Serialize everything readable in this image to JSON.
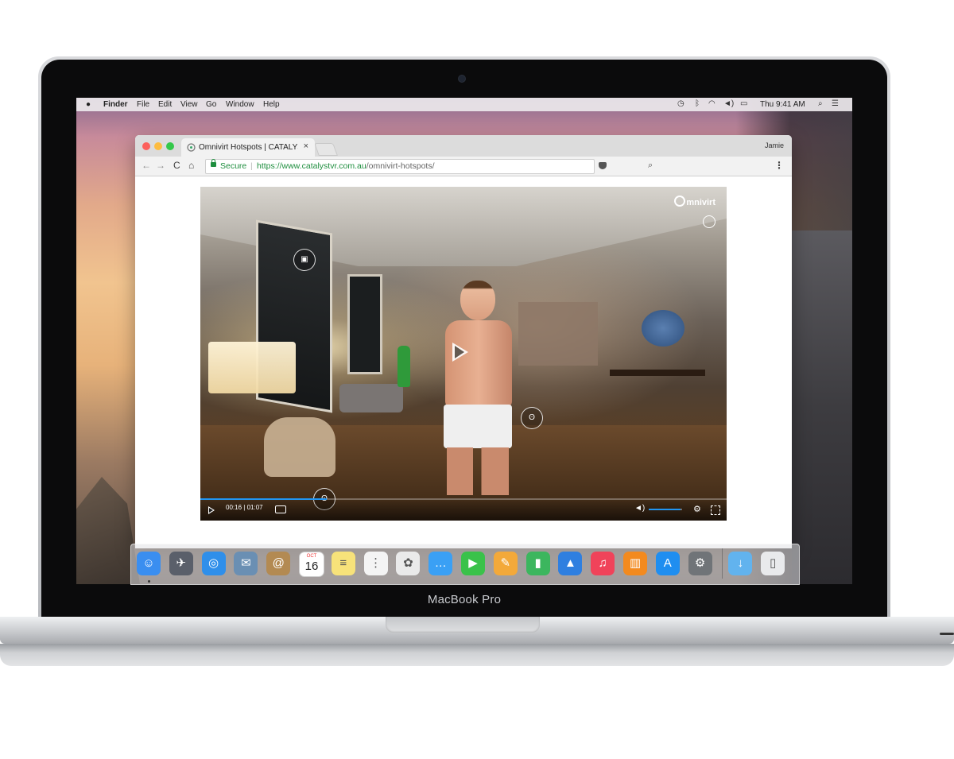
{
  "device": {
    "brand_label": "MacBook Pro"
  },
  "menubar": {
    "app_name": "Finder",
    "menus": [
      "File",
      "Edit",
      "View",
      "Go",
      "Window",
      "Help"
    ],
    "clock": "Thu 9:41 AM"
  },
  "browser": {
    "tab_title": "Omnivirt Hotspots | CATALYST",
    "tab_close": "×",
    "user_name": "Jamie",
    "security_label": "Secure",
    "url_base": "https://www.catalystvr.com.au",
    "url_path": "/omnivirt-hotspots/",
    "nav": {
      "back": "←",
      "forward": "→",
      "reload": "C",
      "home": "⌂"
    },
    "menu_glyph": "⋮"
  },
  "player": {
    "logo_text": "mnivirt",
    "time_current": "00:16",
    "time_separator": "|",
    "time_total": "01:07",
    "progress_fraction": 0.24,
    "volume_fraction": 0.95,
    "hotspots": [
      {
        "name": "hotspot-image",
        "glyph": "▣"
      },
      {
        "name": "hotspot-walk",
        "glyph": "ʘ"
      },
      {
        "name": "hotspot-bottom",
        "glyph": "ʘ"
      }
    ]
  },
  "dock": {
    "icons": [
      {
        "name": "finder-icon",
        "bg": "#3a8ef0",
        "glyph": "☺"
      },
      {
        "name": "launchpad-icon",
        "bg": "#5a5f6a",
        "glyph": "✈"
      },
      {
        "name": "safari-icon",
        "bg": "#2f8fea",
        "glyph": "◎"
      },
      {
        "name": "mail-stamp-icon",
        "bg": "#6a8fb3",
        "glyph": "✉"
      },
      {
        "name": "contacts-icon",
        "bg": "#b38a52",
        "glyph": "@"
      },
      {
        "name": "calendar-icon",
        "bg": "#ffffff",
        "glyph": ""
      },
      {
        "name": "notes-icon",
        "bg": "#f7e27a",
        "glyph": "≡"
      },
      {
        "name": "reminders-icon",
        "bg": "#f4f4f4",
        "glyph": "⋮"
      },
      {
        "name": "photos-icon",
        "bg": "#eaeaea",
        "glyph": "✿"
      },
      {
        "name": "messages-icon",
        "bg": "#3aa0f5",
        "glyph": "…"
      },
      {
        "name": "facetime-icon",
        "bg": "#3ac24a",
        "glyph": "▶"
      },
      {
        "name": "pages-icon",
        "bg": "#f3a93a",
        "glyph": "✎"
      },
      {
        "name": "numbers-icon",
        "bg": "#3cb65e",
        "glyph": "▮"
      },
      {
        "name": "keynote-icon",
        "bg": "#2f7fe0",
        "glyph": "▲"
      },
      {
        "name": "itunes-icon",
        "bg": "#f0435a",
        "glyph": "♫"
      },
      {
        "name": "ibooks-icon",
        "bg": "#f38a1f",
        "glyph": "▥"
      },
      {
        "name": "app-store-icon",
        "bg": "#1f8ef0",
        "glyph": "A"
      },
      {
        "name": "system-preferences-icon",
        "bg": "#707478",
        "glyph": "⚙"
      },
      {
        "name": "downloads-folder-icon",
        "bg": "#62b3ee",
        "glyph": "↓"
      },
      {
        "name": "trash-icon",
        "bg": "#e9eaec",
        "glyph": "▯"
      }
    ],
    "calendar": {
      "month": "OCT",
      "day": "16"
    }
  },
  "colors": {
    "accent": "#2196f3",
    "secure": "#1e8e3e"
  }
}
